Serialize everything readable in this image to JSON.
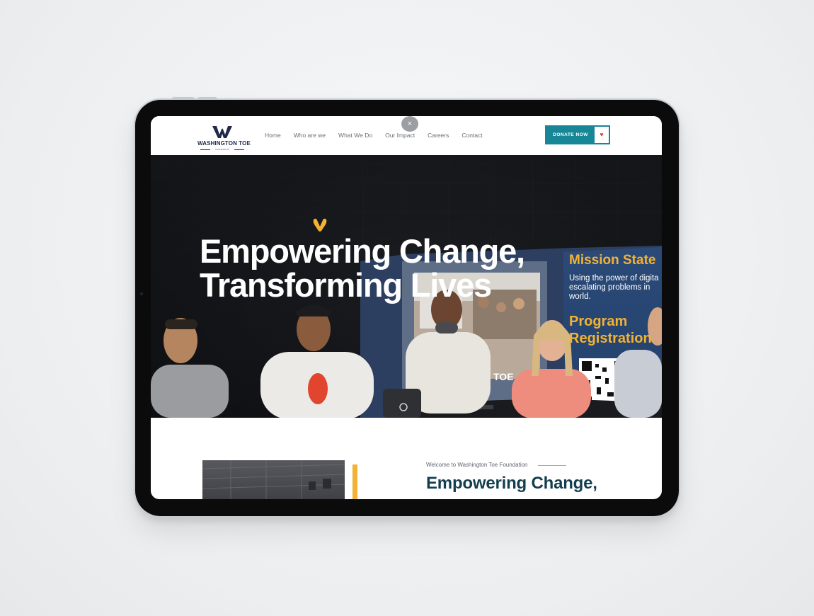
{
  "brand": {
    "name": "WASHINGTON TOE",
    "tagline": "FOUNDATION",
    "colors": {
      "navy": "#1f2a4d",
      "teal": "#178797",
      "accent_yellow": "#f2b233",
      "heading_dark_teal": "#133e4f"
    }
  },
  "nav": {
    "items": [
      "Home",
      "Who are we",
      "What We Do",
      "Our Impact",
      "Careers",
      "Contact"
    ],
    "close_icon": "close-icon",
    "close_glyph": "×",
    "donate_label": "DONATE NOW",
    "donate_icon": "heart-icon"
  },
  "hero": {
    "title_line1": "Empowering Change,",
    "title_line2": "Transforming Lives",
    "banner": {
      "mission": "Mission State",
      "mission_body_line1": "Using the power of digita",
      "mission_body_line2": "escalating  problems  in",
      "mission_body_line3": "world.",
      "program_line1": "Program",
      "program_line2": "Registration",
      "monitor_text": "TOE"
    }
  },
  "intro": {
    "welcome": "Welcome to Washington Toe Foundation",
    "heading": "Empowering Change,"
  }
}
